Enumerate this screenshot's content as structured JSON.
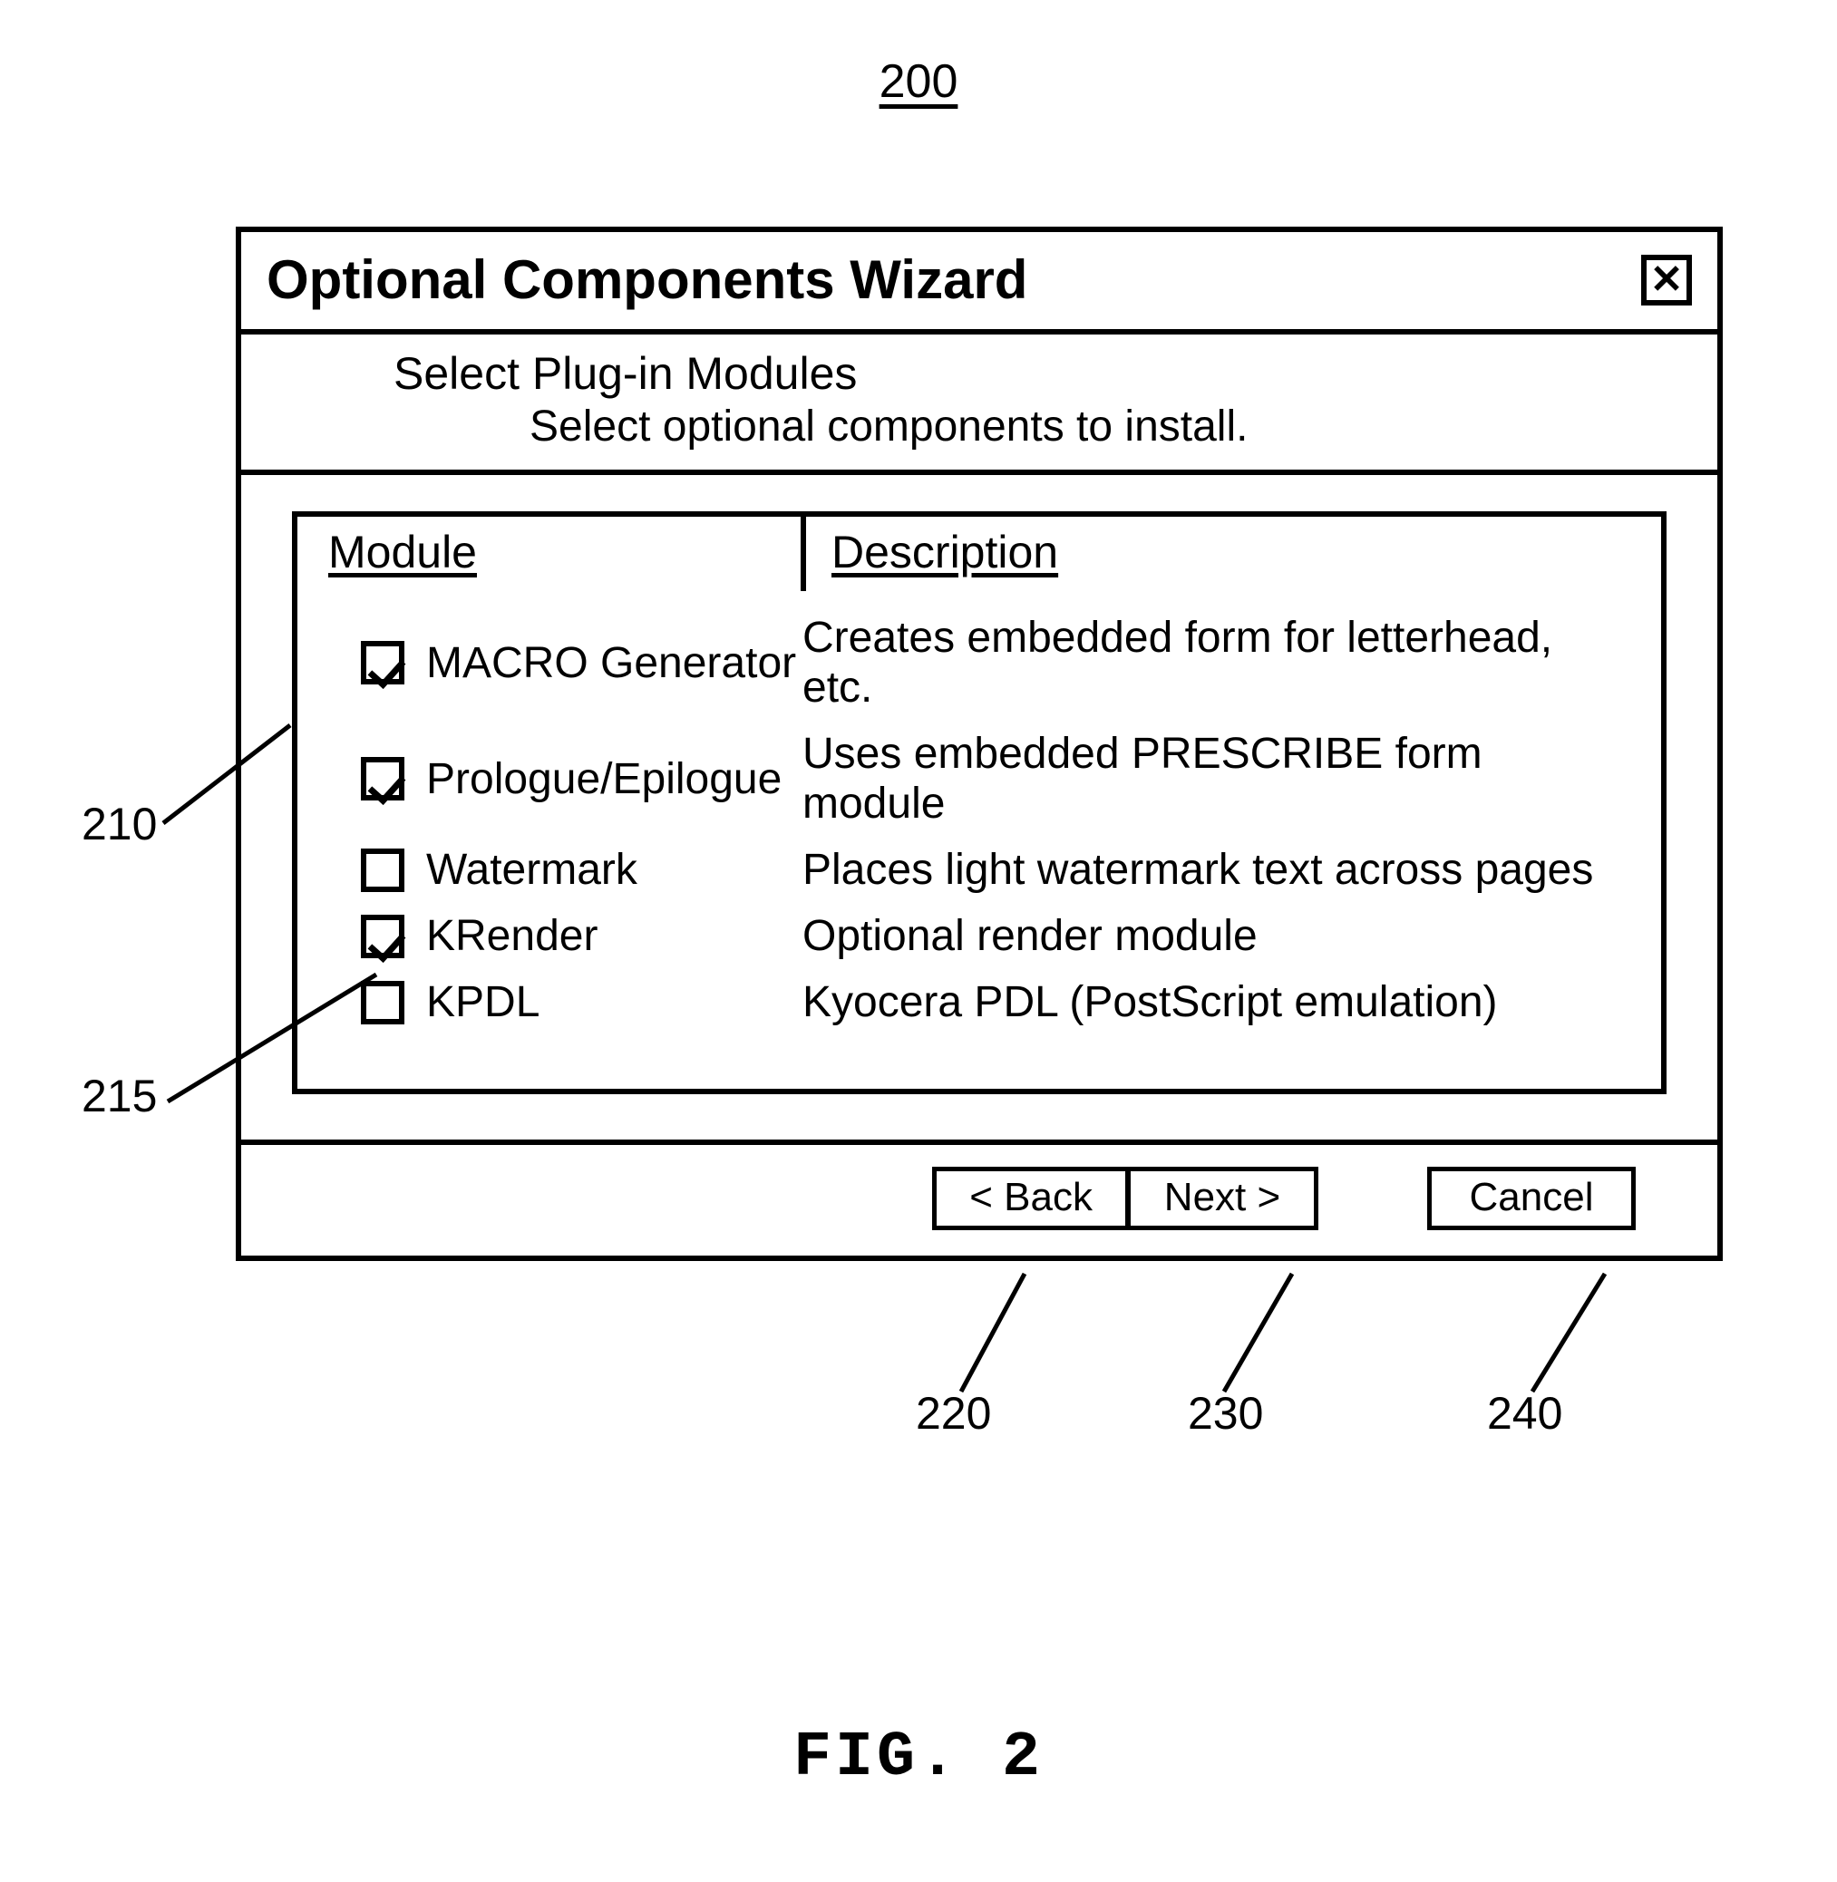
{
  "figure_ref": "200",
  "figure_caption": "FIG. 2",
  "wizard": {
    "title": "Optional Components Wizard",
    "sub_title": "Select Plug-in Modules",
    "sub_desc": "Select optional components to install.",
    "columns": {
      "module": "Module",
      "description": "Description"
    },
    "rows": [
      {
        "checked": true,
        "label": "MACRO Generator",
        "desc": "Creates embedded form for letterhead, etc."
      },
      {
        "checked": true,
        "label": "Prologue/Epilogue",
        "desc": "Uses embedded PRESCRIBE form module"
      },
      {
        "checked": false,
        "label": "Watermark",
        "desc": "Places light watermark text across pages"
      },
      {
        "checked": true,
        "label": "KRender",
        "desc": "Optional render module"
      },
      {
        "checked": false,
        "label": "KPDL",
        "desc": "Kyocera PDL (PostScript emulation)"
      }
    ],
    "buttons": {
      "back": "< Back",
      "next": "Next >",
      "cancel": "Cancel"
    }
  },
  "callouts": {
    "listbox": "210",
    "checkboxes": "215",
    "back": "220",
    "next": "230",
    "cancel": "240"
  }
}
